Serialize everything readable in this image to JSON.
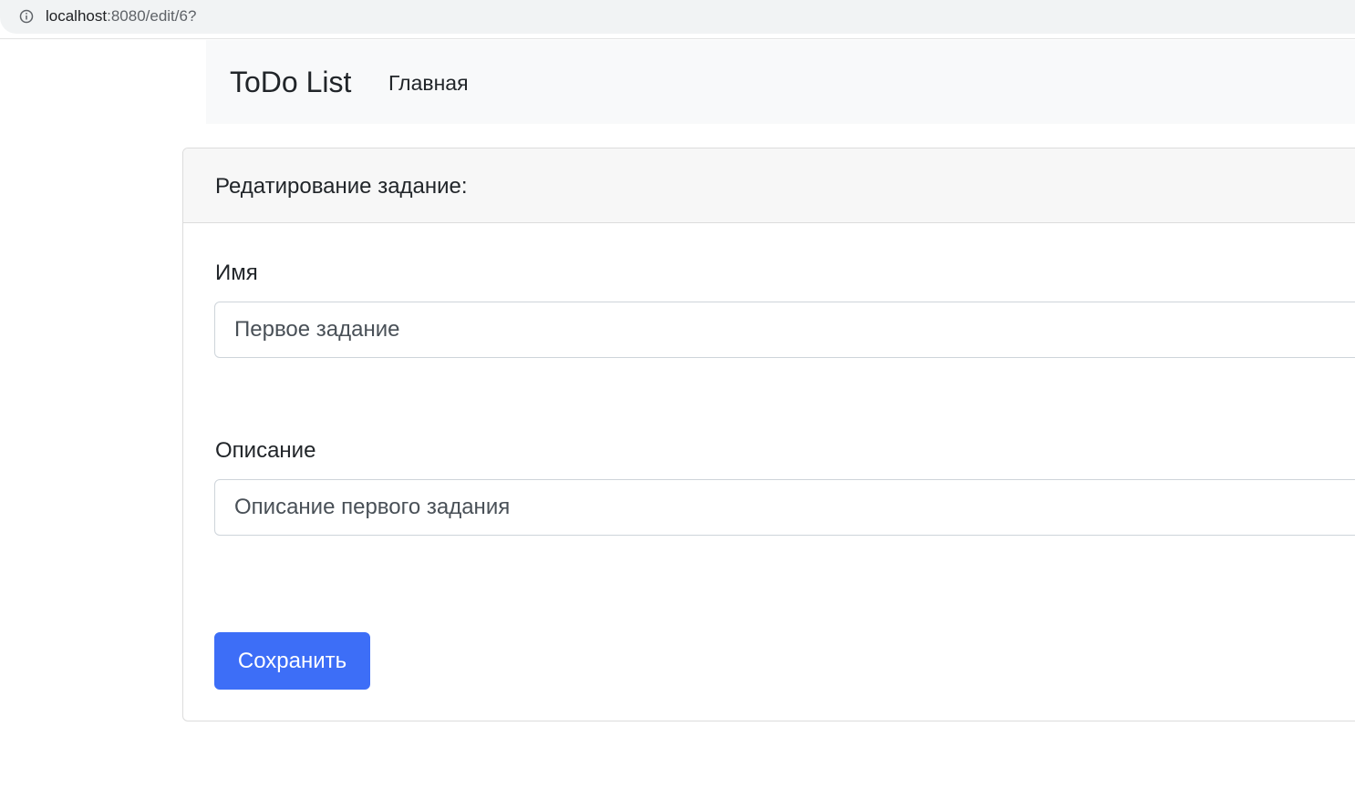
{
  "browser": {
    "url_host": "localhost",
    "url_path": ":8080/edit/6?",
    "icon": "info-icon"
  },
  "navbar": {
    "brand": "ToDo List",
    "links": [
      {
        "label": "Главная"
      }
    ]
  },
  "card": {
    "header": "Редатирование задание:",
    "fields": {
      "name": {
        "label": "Имя",
        "value": "Первое задание"
      },
      "description": {
        "label": "Описание",
        "value": "Описание первого задания"
      }
    },
    "submit_label": "Сохранить"
  },
  "colors": {
    "primary": "#3d6ef7",
    "navbar_bg": "#f8f9fa",
    "card_header_bg": "#f7f7f7",
    "address_bar_bg": "#f1f3f4"
  }
}
